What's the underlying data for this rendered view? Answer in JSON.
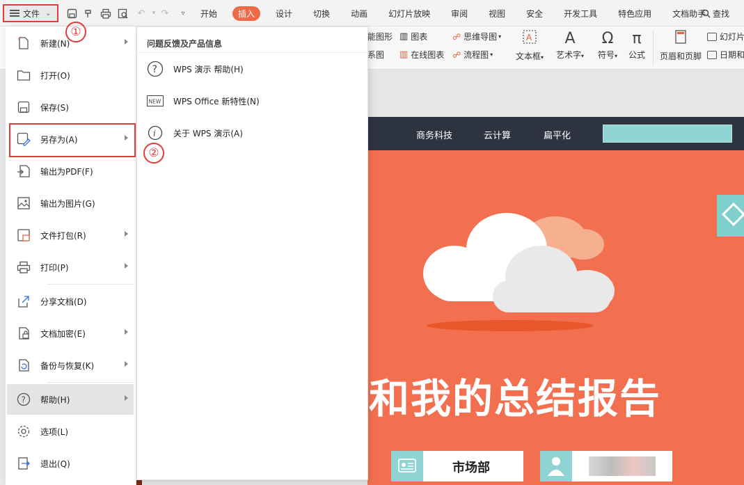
{
  "menubar": {
    "file_label": "文件",
    "tabs": [
      "开始",
      "插入",
      "设计",
      "切换",
      "动画",
      "幻灯片放映",
      "审阅",
      "视图",
      "安全",
      "开发工具",
      "特色应用",
      "文档助手"
    ],
    "active_tab": "插入",
    "search_label": "查找"
  },
  "ribbon": {
    "items": [
      "能图形",
      "图表",
      "思维导图",
      "系图",
      "在线图表",
      "流程图",
      "文本框",
      "艺术字",
      "符号",
      "公式",
      "页眉和页脚",
      "幻灯片",
      "日期和"
    ]
  },
  "file_menu": {
    "items": [
      {
        "label": "新建(N)",
        "icon": "new-file-icon",
        "has_submenu": true
      },
      {
        "label": "打开(O)",
        "icon": "folder-open-icon",
        "has_submenu": false
      },
      {
        "label": "保存(S)",
        "icon": "save-icon",
        "has_submenu": false
      },
      {
        "label": "另存为(A)",
        "icon": "save-as-icon",
        "has_submenu": true
      },
      {
        "label": "输出为PDF(F)",
        "icon": "export-pdf-icon",
        "has_submenu": false
      },
      {
        "label": "输出为图片(G)",
        "icon": "export-image-icon",
        "has_submenu": false
      },
      {
        "label": "文件打包(R)",
        "icon": "package-icon",
        "has_submenu": true
      },
      {
        "label": "打印(P)",
        "icon": "print-icon",
        "has_submenu": true
      },
      {
        "label": "分享文档(D)",
        "icon": "share-icon",
        "has_submenu": false
      },
      {
        "label": "文档加密(E)",
        "icon": "lock-icon",
        "has_submenu": true
      },
      {
        "label": "备份与恢复(K)",
        "icon": "backup-icon",
        "has_submenu": true
      },
      {
        "label": "帮助(H)",
        "icon": "help-icon",
        "has_submenu": true
      },
      {
        "label": "选项(L)",
        "icon": "gear-icon",
        "has_submenu": false
      },
      {
        "label": "退出(Q)",
        "icon": "exit-icon",
        "has_submenu": false
      }
    ],
    "hovered": "帮助(H)"
  },
  "help_submenu": {
    "title": "问题反馈及产品信息",
    "items": [
      {
        "label": "WPS 演示 帮助(H)",
        "icon": "question-icon"
      },
      {
        "label": "WPS Office 新特性(N)",
        "icon": "new-badge-icon",
        "badge": "NEW"
      },
      {
        "label": "关于 WPS 演示(A)",
        "icon": "info-icon"
      }
    ]
  },
  "slide": {
    "nav": [
      "商务科技",
      "云计算",
      "扁平化"
    ],
    "title": "和我的总结报告",
    "department": "市场部"
  },
  "annotations": {
    "marker1": "①",
    "marker2": "②"
  }
}
